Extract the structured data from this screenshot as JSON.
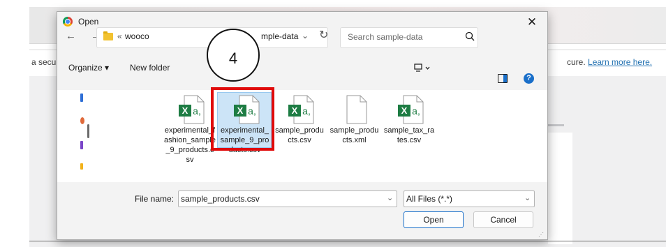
{
  "background": {
    "notice_left": "a secu",
    "notice_right_text": "cure.",
    "notice_link": "Learn more here."
  },
  "dialog": {
    "title": "Open",
    "close_icon": "close-icon",
    "nav": {
      "back": "←",
      "forward": "→",
      "history": "⌄",
      "up": "↑",
      "address_prefix": "«",
      "address_folder_partial": "wooco",
      "address_current_partial": "mple-data",
      "dropdown": "⌄",
      "refresh": "↻"
    },
    "search": {
      "placeholder": "Search sample-data"
    },
    "toolbar": {
      "organize": "Organize ▾",
      "new_folder": "New folder",
      "help": "?"
    },
    "files": [
      {
        "label": "experimental_fashion_sample_9_products.csv",
        "icon": "excel-csv-icon"
      },
      {
        "label": "experimental_sample_9_products.csv",
        "icon": "excel-csv-icon"
      },
      {
        "label": "sample_products.csv",
        "icon": "excel-csv-icon",
        "selected": true
      },
      {
        "label": "sample_products.xml",
        "icon": "blank-file-icon"
      },
      {
        "label": "sample_tax_rates.csv",
        "icon": "excel-csv-icon"
      }
    ],
    "file_name_label": "File name:",
    "file_name_value": "sample_products.csv",
    "file_type": "All Files (*.*)",
    "open_label": "Open",
    "cancel_label": "Cancel"
  },
  "annotation": {
    "step": "4",
    "highlight_color": "#e00b0b"
  },
  "colors": {
    "accent": "#1a6fc9",
    "excel_green": "#1d7c43",
    "selection": "#cce4f7"
  }
}
